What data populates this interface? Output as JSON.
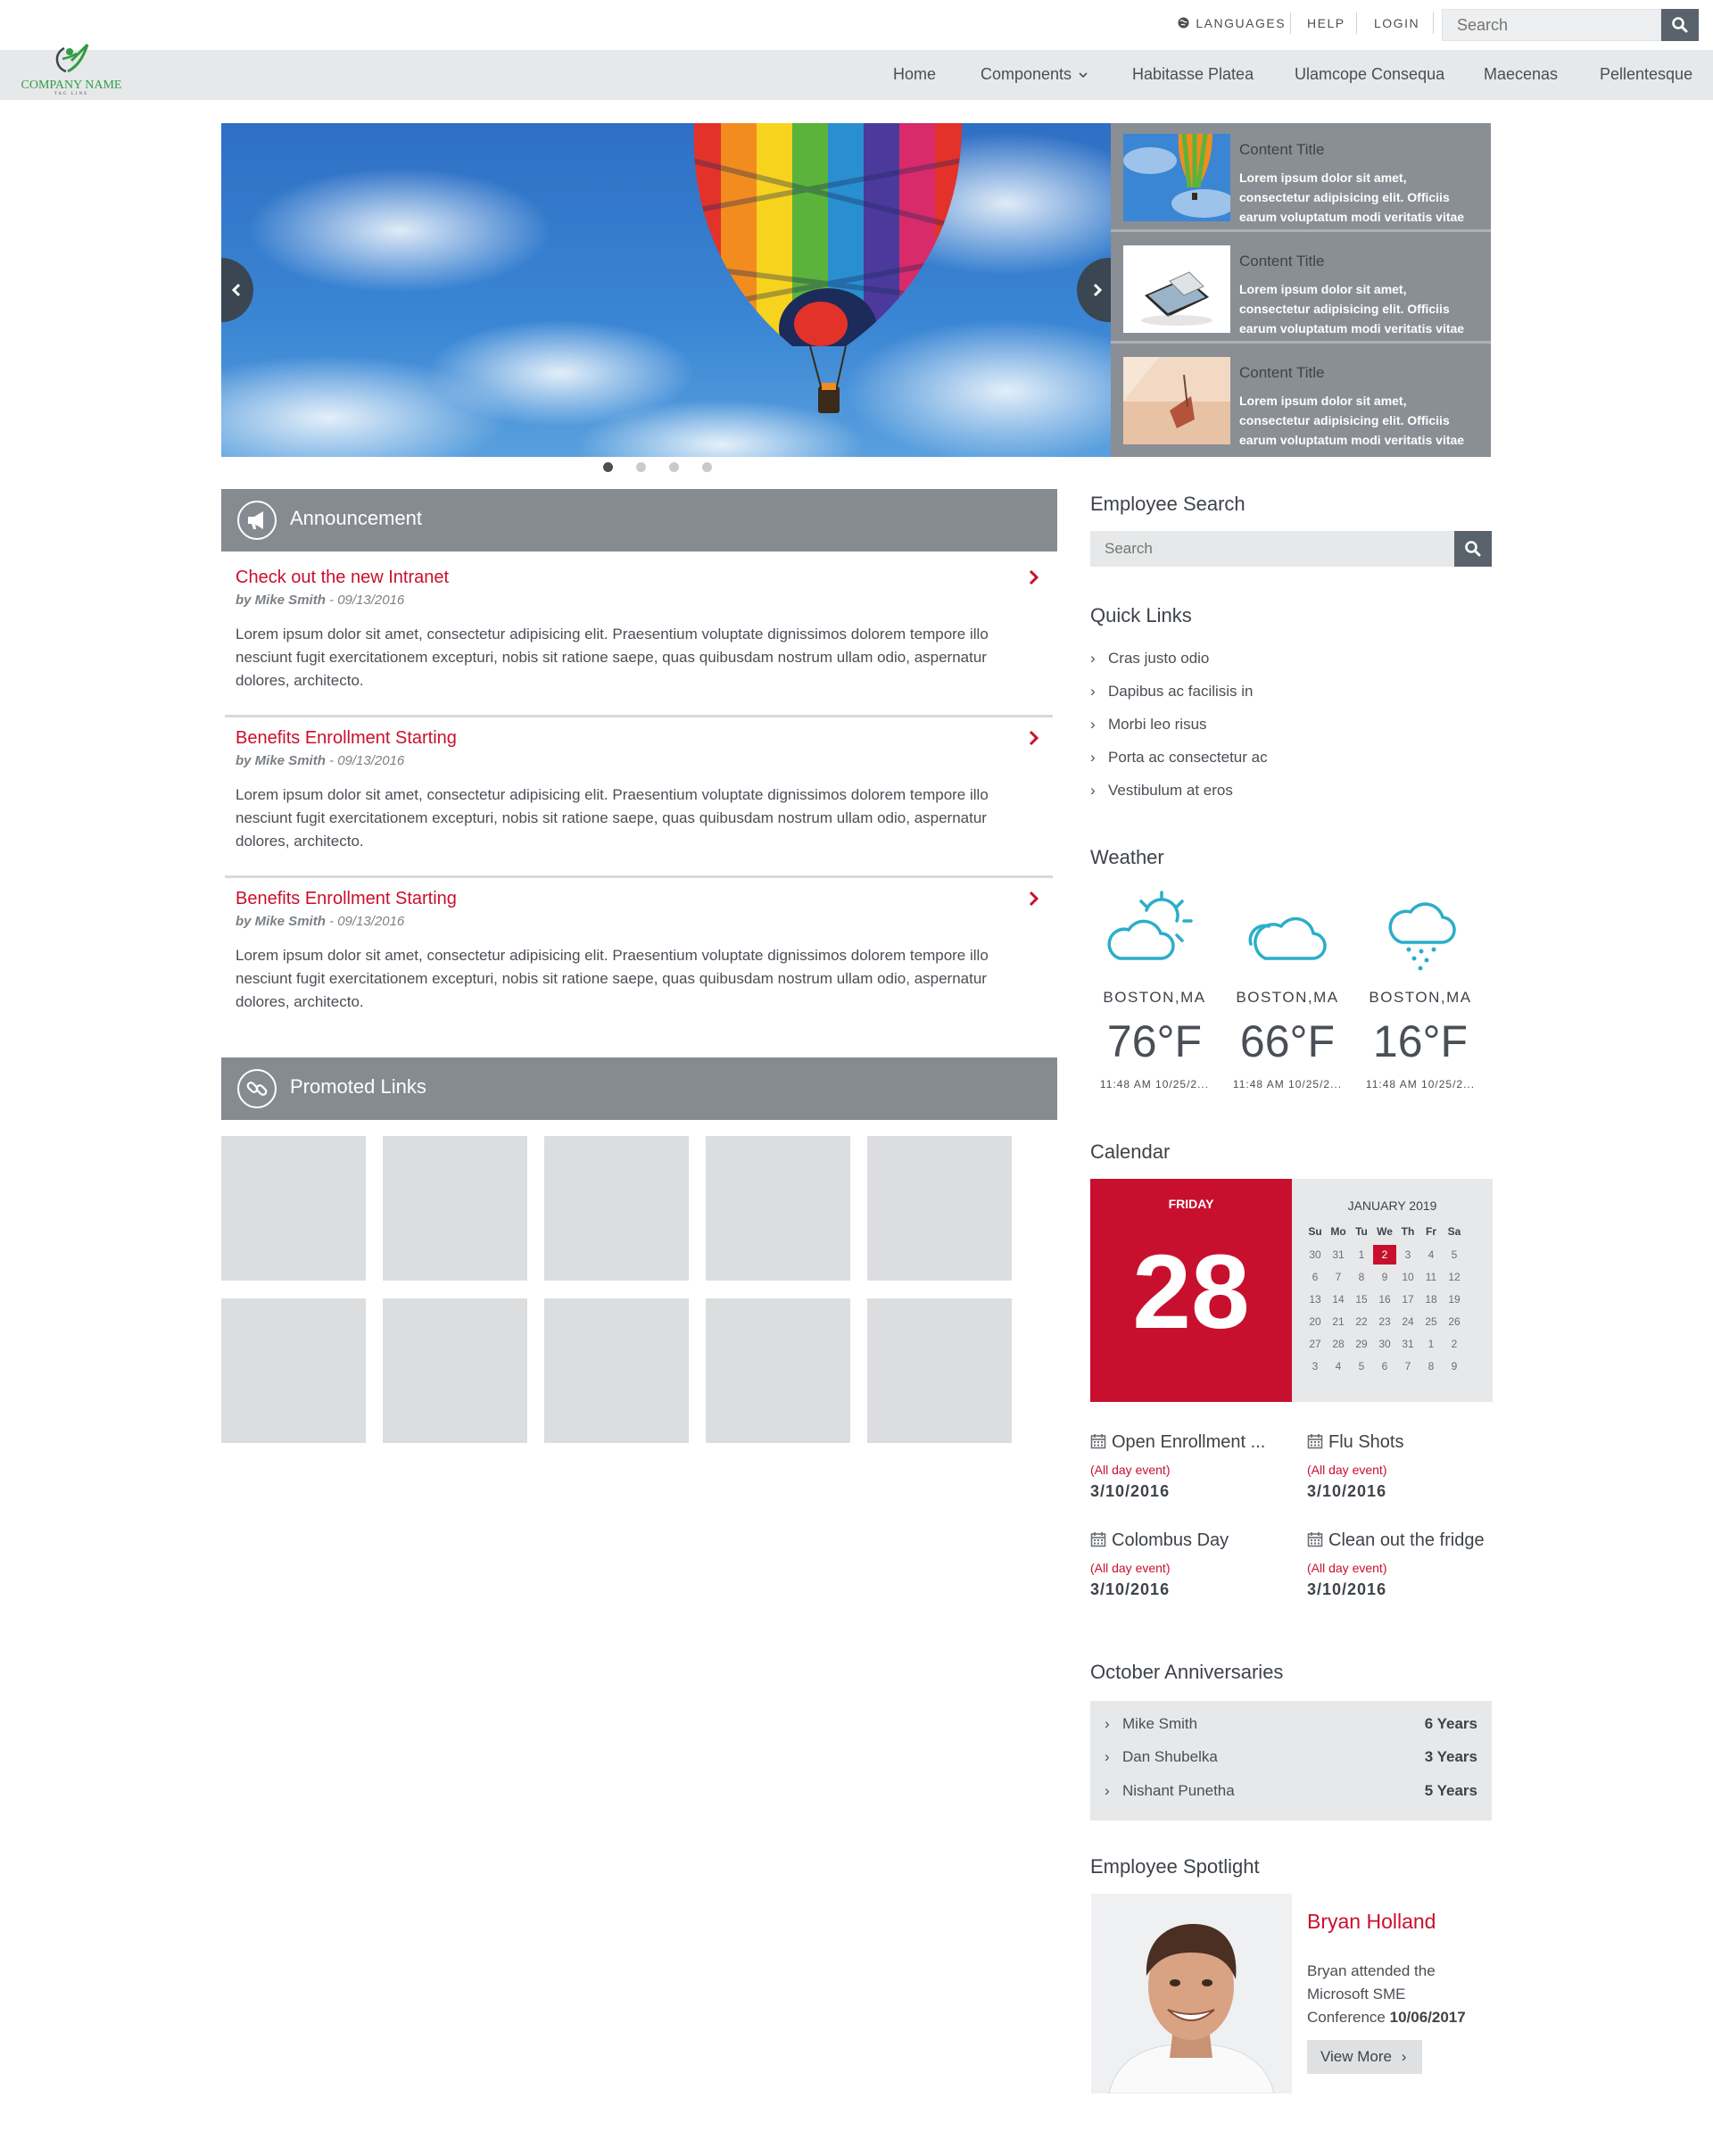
{
  "logo": {
    "company": "COMPANY NAME",
    "tagline": "TAG LINE"
  },
  "utility": {
    "languages": "LANGUAGES",
    "help": "HELP",
    "login": "LOGIN",
    "search_placeholder": "Search"
  },
  "nav": [
    "Home",
    "Components",
    "Habitasse Platea",
    "Ulamcope Consequa",
    "Maecenas",
    "Pellentesque"
  ],
  "carousel": {
    "cards": [
      {
        "title": "Content Title",
        "text": "Lorem ipsum dolor sit amet, consectetur adipisicing elit. Officiis earum voluptatum modi veritatis vitae"
      },
      {
        "title": "Content Title",
        "text": "Lorem ipsum dolor sit amet, consectetur adipisicing elit. Officiis earum voluptatum modi veritatis vitae"
      },
      {
        "title": "Content Title",
        "text": "Lorem ipsum dolor sit amet, consectetur adipisicing elit. Officiis earum voluptatum modi veritatis vitae"
      }
    ],
    "active_slide": 1,
    "slide_count": 4
  },
  "announcement": {
    "title": "Announcement",
    "items": [
      {
        "title": "Check out the new Intranet",
        "author": "by Mike Smith",
        "date": " - 09/13/2016",
        "body": "Lorem ipsum dolor sit amet, consectetur adipisicing elit. Praesentium voluptate dignissimos dolorem tempore illo nesciunt fugit exercitationem excepturi, nobis sit ratione saepe, quas quibusdam nostrum ullam odio, aspernatur dolores, architecto."
      },
      {
        "title": "Benefits Enrollment Starting",
        "author": "by Mike Smith",
        "date": " - 09/13/2016",
        "body": "Lorem ipsum dolor sit amet, consectetur adipisicing elit. Praesentium voluptate dignissimos dolorem tempore illo nesciunt fugit exercitationem excepturi, nobis sit ratione saepe, quas quibusdam nostrum ullam odio, aspernatur dolores, architecto."
      },
      {
        "title": "Benefits Enrollment Starting",
        "author": "by Mike Smith",
        "date": " - 09/13/2016",
        "body": "Lorem ipsum dolor sit amet, consectetur adipisicing elit. Praesentium voluptate dignissimos dolorem tempore illo nesciunt fugit exercitationem excepturi, nobis sit ratione saepe, quas quibusdam nostrum ullam odio, aspernatur dolores, architecto."
      }
    ]
  },
  "promoted": {
    "title": "Promoted Links"
  },
  "employee_search": {
    "title": "Employee Search",
    "placeholder": "Search"
  },
  "quick_links": {
    "title": "Quick Links",
    "items": [
      "Cras justo odio",
      "Dapibus ac facilisis in",
      "Morbi leo risus",
      "Porta ac consectetur ac",
      "Vestibulum at eros"
    ]
  },
  "weather": {
    "title": "Weather",
    "items": [
      {
        "icon": "partly-sunny-icon",
        "city": "BOSTON,MA",
        "temp": "76°F",
        "time": "11:48 AM 10/25/2..."
      },
      {
        "icon": "cloudy-icon",
        "city": "BOSTON,MA",
        "temp": "66°F",
        "time": "11:48 AM 10/25/2..."
      },
      {
        "icon": "rain-icon",
        "city": "BOSTON,MA",
        "temp": "16°F",
        "time": "11:48 AM 10/25/2..."
      }
    ]
  },
  "calendar": {
    "title": "Calendar",
    "weekday": "FRIDAY",
    "day": "28",
    "month": "JANUARY 2019",
    "headers": [
      "Su",
      "Mo",
      "Tu",
      "We",
      "Th",
      "Fr",
      "Sa"
    ],
    "weeks": [
      [
        "30",
        "31",
        "1",
        "2",
        "3",
        "4",
        "5"
      ],
      [
        "6",
        "7",
        "8",
        "9",
        "10",
        "11",
        "12"
      ],
      [
        "13",
        "14",
        "15",
        "16",
        "17",
        "18",
        "19"
      ],
      [
        "20",
        "21",
        "22",
        "23",
        "24",
        "25",
        "26"
      ],
      [
        "27",
        "28",
        "29",
        "30",
        "31",
        "1",
        "2"
      ],
      [
        "3",
        "4",
        "5",
        "6",
        "7",
        "8",
        "9"
      ]
    ],
    "highlight": "2",
    "accent": "#c8102e",
    "events": [
      {
        "title": "Open Enrollment ...",
        "sub": "(All day event)",
        "date": "3/10/2016"
      },
      {
        "title": "Flu Shots",
        "sub": "(All day event)",
        "date": "3/10/2016"
      },
      {
        "title": "Colombus Day",
        "sub": "(All day event)",
        "date": "3/10/2016"
      },
      {
        "title": "Clean out the fridge",
        "sub": "(All day event)",
        "date": "3/10/2016"
      }
    ]
  },
  "anniversaries": {
    "title": "October Anniversaries",
    "items": [
      {
        "name": "Mike Smith",
        "years": "6 Years"
      },
      {
        "name": "Dan Shubelka",
        "years": "3 Years"
      },
      {
        "name": "Nishant Punetha",
        "years": "5 Years"
      }
    ]
  },
  "spotlight": {
    "title": "Employee Spotlight",
    "name": "Bryan Holland",
    "text": "Bryan attended the Microsoft SME Conference",
    "date": "10/06/2017",
    "button": "View More"
  }
}
